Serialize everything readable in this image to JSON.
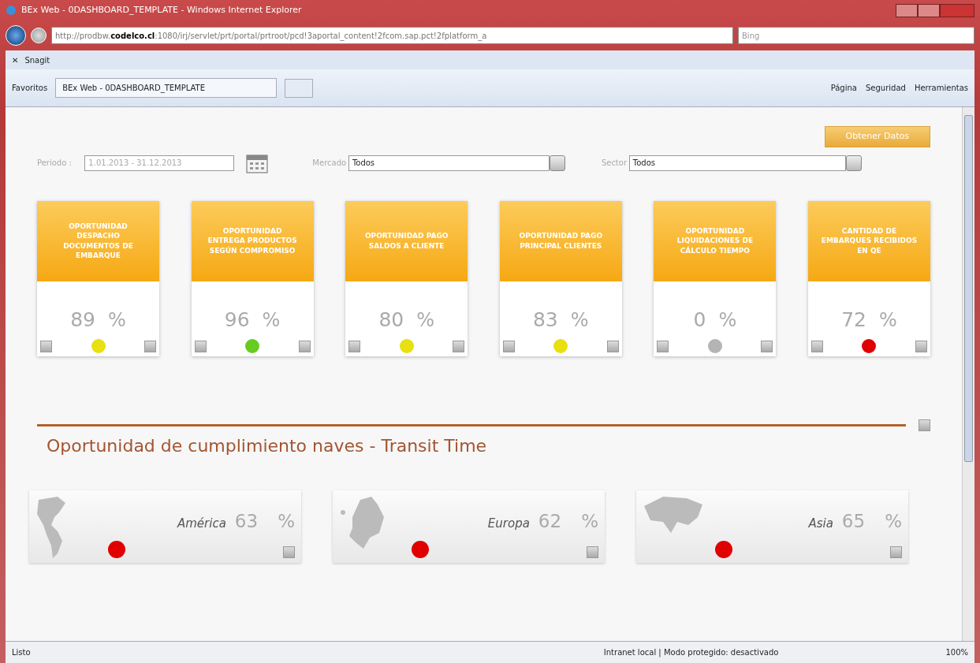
{
  "window": {
    "title": "BEx Web - 0DASHBOARD_TEMPLATE - Windows Internet Explorer"
  },
  "address_bar": {
    "url_before": "http://prodbw.",
    "url_bold": "codelco.cl",
    "url_after": ":1080/irj/servlet/prt/portal/prtroot/pcd!3aportal_content!2fcom.sap.pct!2fplatform_a",
    "search_placeholder": "Bing"
  },
  "links_bar": {
    "close": "✕",
    "items": [
      "Snagit"
    ]
  },
  "favorites_bar": {
    "favorites": "Favoritos",
    "tab": "BEx Web - 0DASHBOARD_TEMPLATE",
    "menus": [
      "Página",
      "Seguridad",
      "Herramientas"
    ]
  },
  "filters": {
    "button": "Obtener Datos",
    "period_label": "Periodo :",
    "period_value": "1.01.2013 - 31.12.2013",
    "market_label": "Mercado",
    "market_value": "Todos",
    "sector_label": "Sector",
    "sector_value": "Todos"
  },
  "kpis": [
    {
      "title": "OPORTUNIDAD DESPACHO DOCUMENTOS DE EMBARQUE",
      "value": "89",
      "unit": "%",
      "color": "#e8e010"
    },
    {
      "title": "OPORTUNIDAD ENTREGA PRODUCTOS SEGÚN COMPROMISO",
      "value": "96",
      "unit": "%",
      "color": "#66cc22"
    },
    {
      "title": "OPORTUNIDAD PAGO SALDOS A CLIENTE",
      "value": "80",
      "unit": "%",
      "color": "#e8e010"
    },
    {
      "title": "OPORTUNIDAD PAGO PRINCIPAL CLIENTES",
      "value": "83",
      "unit": "%",
      "color": "#e8e010"
    },
    {
      "title": "OPORTUNIDAD LIQUIDACIONES DE CÁLCULO TIEMPO",
      "value": "0",
      "unit": "%",
      "color": "#b4b4b4"
    },
    {
      "title": "CANTIDAD DE EMBARQUES RECIBIDOS EN QE",
      "value": "72",
      "unit": "%",
      "color": "#e00000"
    }
  ],
  "section": {
    "title": "Oportunidad de cumplimiento naves - Transit Time"
  },
  "regions": [
    {
      "name": "América",
      "value": "63",
      "unit": "%",
      "color": "#e00000",
      "kind": "americas"
    },
    {
      "name": "Europa",
      "value": "62",
      "unit": "%",
      "color": "#e00000",
      "kind": "europe"
    },
    {
      "name": "Asia",
      "value": "65",
      "unit": "%",
      "color": "#e00000",
      "kind": "asia"
    }
  ],
  "status_bar": {
    "left": "Listo",
    "zone": "Intranet local | Modo protegido: desactivado",
    "zoom": "100%"
  }
}
